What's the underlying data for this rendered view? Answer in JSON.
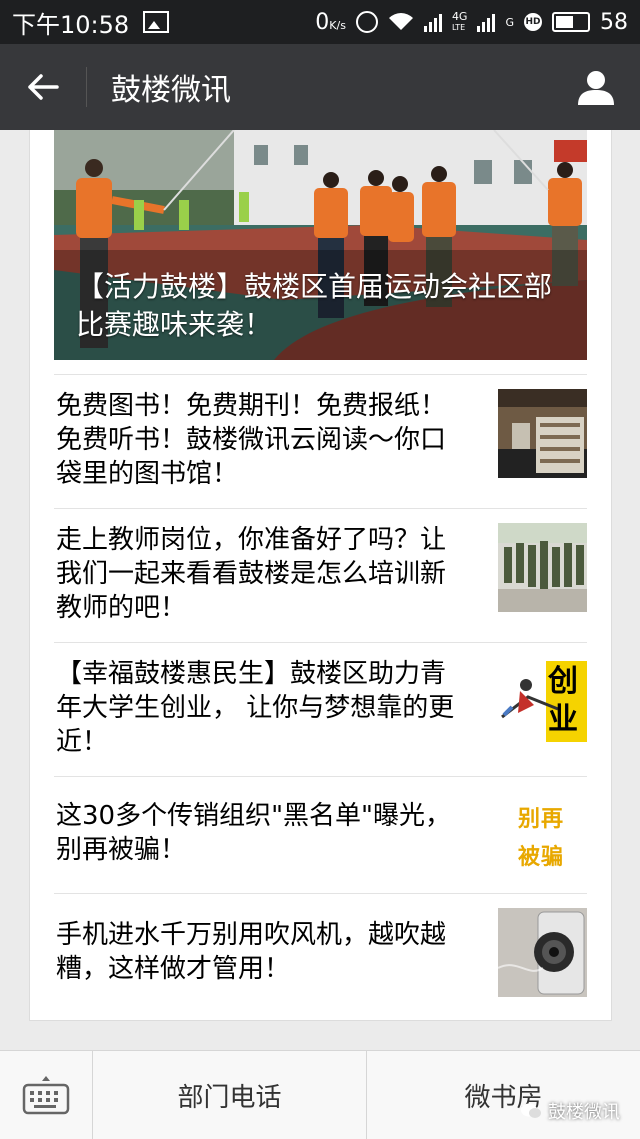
{
  "status": {
    "time": "下午10:58",
    "speed": "0",
    "speed_unit": "K/s",
    "net1": "4G",
    "net1_sub": "LTE",
    "net2": "G",
    "hd": "HD",
    "battery": "58"
  },
  "nav": {
    "title": "鼓楼微讯"
  },
  "hero": {
    "caption": "【活力鼓楼】鼓楼区首届运动会社区部比赛趣味来袭！"
  },
  "articles": [
    {
      "title": "免费图书！免费期刊！免费报纸！免费听书！鼓楼微讯云阅读～你口袋里的图书馆！",
      "thumb": "library"
    },
    {
      "title": "走上教师岗位，你准备好了吗？让我们一起来看看鼓楼是怎么培训新教师的吧！",
      "thumb": "training"
    },
    {
      "title": "【幸福鼓楼惠民生】鼓楼区助力青年大学生创业， 让你与梦想靠的更近！",
      "thumb": "startup",
      "thumb_text": "创业"
    },
    {
      "title": "这30多个传销组织\"黑名单\"曝光，别再被骗！",
      "thumb": "warning",
      "thumb_text": "别再被骗"
    },
    {
      "title": "手机进水千万别用吹风机，越吹越糟，这样做才管用！",
      "thumb": "phone"
    }
  ],
  "bottom": {
    "menu1": "部门电话",
    "menu2": "微书房",
    "watermark": "鼓楼微讯"
  },
  "colors": {
    "status_bg": "#1e1f21",
    "nav_bg": "#37383b",
    "accent_yellow": "#f5d300"
  }
}
